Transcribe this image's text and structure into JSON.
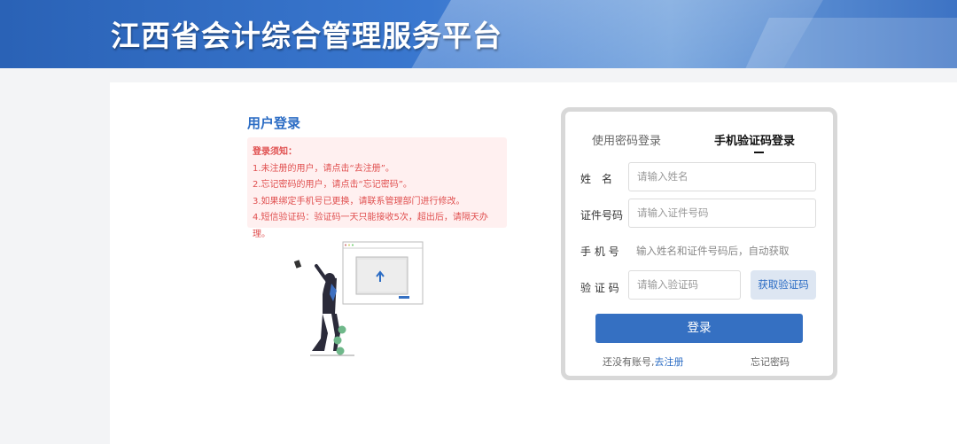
{
  "header": {
    "title": "江西省会计综合管理服务平台"
  },
  "left": {
    "title": "用户登录",
    "notice": {
      "heading": "登录须知：",
      "items": [
        "1.未注册的用户，请点击“去注册”。",
        "2.忘记密码的用户，请点击“忘记密码”。",
        "3.如果绑定手机号已更换，请联系管理部门进行修改。",
        "4.短信验证码：验证码一天只能接收5次，超出后，请隔天办理。"
      ]
    }
  },
  "login": {
    "tabs": [
      "使用密码登录",
      "手机验证码登录"
    ],
    "active_tab": "手机验证码登录",
    "fields": {
      "name_label": "姓　名",
      "name_placeholder": "请输入姓名",
      "id_label": "证件号码",
      "id_placeholder": "请输入证件号码",
      "phone_label": "手 机 号",
      "phone_hint": "输入姓名和证件号码后，自动获取",
      "code_label": "验 证 码",
      "code_placeholder": "请输入验证码"
    },
    "get_code_button": "获取验证码",
    "login_button": "登录",
    "no_account_text": "还没有账号,",
    "register_link": "去注册",
    "forgot_password": "忘记密码"
  },
  "colors": {
    "accent": "#3570c2",
    "notice_text": "#e05050",
    "notice_bg": "#fff0f0"
  }
}
